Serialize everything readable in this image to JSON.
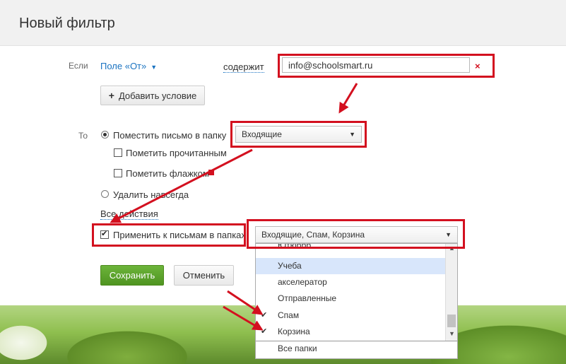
{
  "dialog": {
    "title": "Новый фильтр"
  },
  "condition": {
    "if_label": "Если",
    "field_label": "Поле «От»",
    "operator_label": "содержит",
    "value": "info@schoolsmart.ru",
    "clear_label": "×",
    "add_condition_label": "Добавить условие"
  },
  "actions": {
    "then_label": "То",
    "move_to_folder_label": "Поместить письмо в папку",
    "folder_value": "Входящие",
    "mark_read_label": "Пометить прочитанным",
    "mark_flag_label": "Пометить флажком",
    "delete_label": "Удалить навсегда",
    "all_actions_label": "Все действия"
  },
  "apply": {
    "label": "Применить к письмам в папках",
    "checked": true,
    "folders_value": "Входящие, Спам, Корзина"
  },
  "dropdown": {
    "items": [
      {
        "label": "Ютюббб",
        "checked": false,
        "highlighted": false
      },
      {
        "label": "Учеба",
        "checked": false,
        "highlighted": true
      },
      {
        "label": "акселератор",
        "checked": false,
        "highlighted": false
      },
      {
        "label": "Отправленные",
        "checked": false,
        "highlighted": false
      },
      {
        "label": "Спам",
        "checked": true,
        "highlighted": false
      },
      {
        "label": "Корзина",
        "checked": true,
        "highlighted": false
      }
    ],
    "all_folders_label": "Все папки"
  },
  "buttons": {
    "save_label": "Сохранить",
    "cancel_label": "Отменить"
  },
  "colors": {
    "accent_link": "#1a73c1",
    "annotation_red": "#d3101f",
    "save_green": "#5aa22c"
  }
}
